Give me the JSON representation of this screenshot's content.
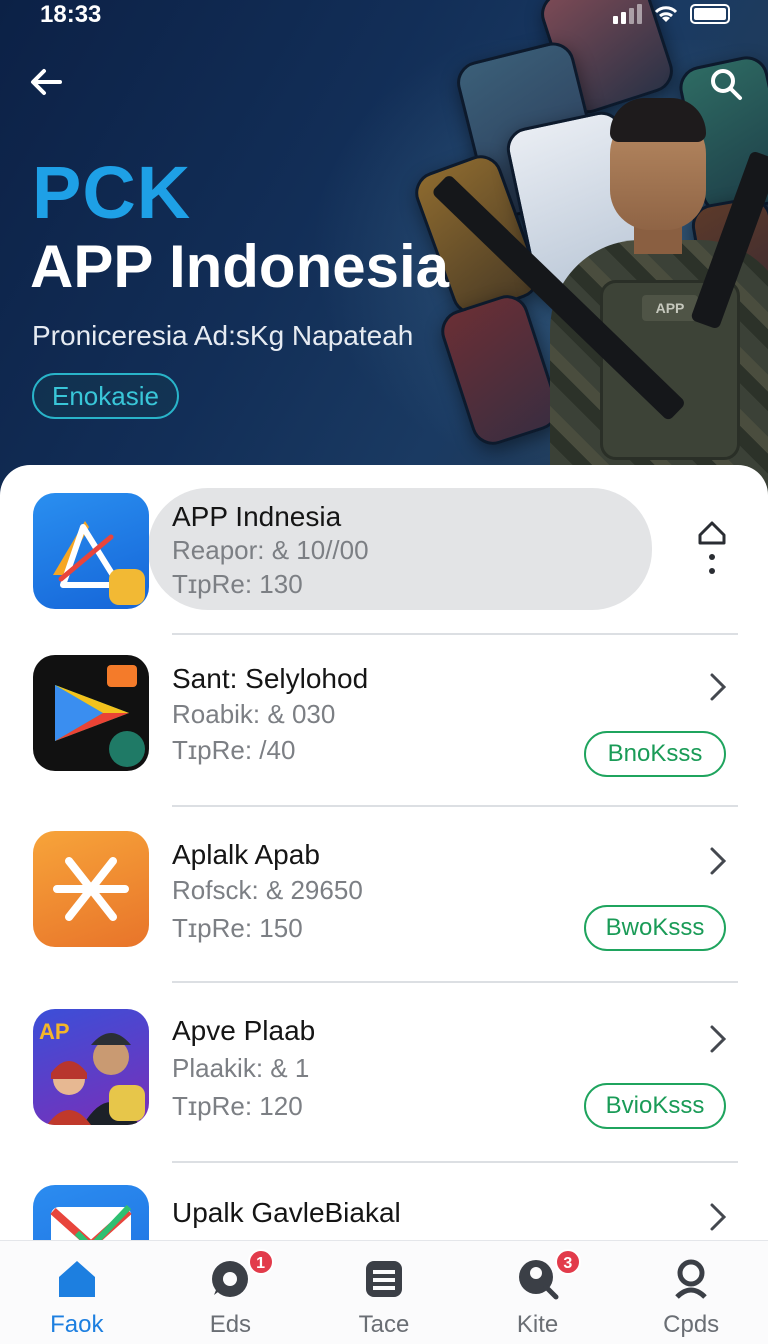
{
  "status_bar": {
    "time": "18:33"
  },
  "hero": {
    "brand": "PCK",
    "title": "APP Indonesia",
    "subtitle": "Proniceresia Ad:sKg Napateah",
    "chip_label": "Enokasie",
    "vest_label": "APP"
  },
  "apps": [
    {
      "name": "APP Indnesia",
      "meta1": "Reapor: & 10//00",
      "meta2": "TɪpRe: 130",
      "icon": "triangle-logo-icon",
      "selected": true
    },
    {
      "name": "Sant: Selylohod",
      "meta1": "Roabik: & 030",
      "meta2": "TɪpRe: /40",
      "icon": "play-logo-icon",
      "action": "BnoKsss"
    },
    {
      "name": "Aplalk Apab",
      "meta1": "Rofsck: & 29650",
      "meta2": "TɪpRe: 150",
      "icon": "asterisk-logo-icon",
      "action": "BwoKsss"
    },
    {
      "name": "Apve Plaab",
      "meta1": "Plaakik: & 1",
      "meta2": "TɪpRe: 120",
      "icon": "game-poster-icon",
      "action": "BvioKsss"
    },
    {
      "name": "Upalk GavleBiakal",
      "icon": "envelope-logo-icon"
    }
  ],
  "tabs": [
    {
      "label": "Faok",
      "icon": "home-icon",
      "active": true
    },
    {
      "label": "Eds",
      "icon": "chat-icon",
      "badge": "1"
    },
    {
      "label": "Tace",
      "icon": "list-icon"
    },
    {
      "label": "Kite",
      "icon": "profile-icon",
      "badge": "3"
    },
    {
      "label": "Cpds",
      "icon": "search-icon"
    }
  ],
  "colors": {
    "brand_blue": "#1ea0e6",
    "accent_green": "#1a9b57",
    "active_tab": "#1d7fe0",
    "badge_red": "#e23b4b"
  }
}
